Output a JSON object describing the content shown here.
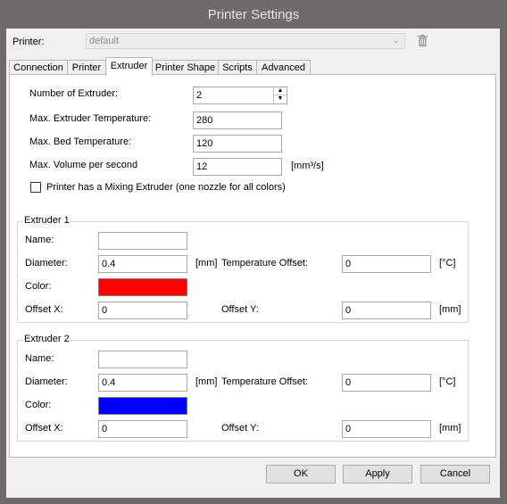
{
  "window": {
    "title": "Printer Settings"
  },
  "printer": {
    "label": "Printer:",
    "value": "default"
  },
  "tabs": [
    {
      "label": "Connection"
    },
    {
      "label": "Printer"
    },
    {
      "label": "Extruder",
      "active": true
    },
    {
      "label": "Printer Shape"
    },
    {
      "label": "Scripts"
    },
    {
      "label": "Advanced"
    }
  ],
  "extruder_page": {
    "num_extruders_label": "Number of Extruder:",
    "num_extruders_value": "2",
    "max_extruder_temp_label": "Max. Extruder Temperature:",
    "max_extruder_temp_value": "280",
    "max_bed_temp_label": "Max. Bed Temperature:",
    "max_bed_temp_value": "120",
    "max_volume_label": "Max. Volume per second",
    "max_volume_value": "12",
    "max_volume_unit": "[mm³/s]",
    "mixing_label": "Printer has a Mixing Extruder (one nozzle for all colors)",
    "mixing_checked": false
  },
  "extruders": [
    {
      "title": "Extruder 1",
      "name_label": "Name:",
      "name_value": "",
      "diameter_label": "Diameter:",
      "diameter_value": "0.4",
      "diameter_unit": "[mm]",
      "temp_offset_label": "Temperature Offset:",
      "temp_offset_value": "0",
      "temp_offset_unit": "[°C]",
      "color_label": "Color:",
      "color": "#ff0000",
      "offset_x_label": "Offset X:",
      "offset_x_value": "0",
      "offset_y_label": "Offset Y:",
      "offset_y_value": "0",
      "offset_y_unit": "[mm]"
    },
    {
      "title": "Extruder 2",
      "name_label": "Name:",
      "name_value": "",
      "diameter_label": "Diameter:",
      "diameter_value": "0.4",
      "diameter_unit": "[mm]",
      "temp_offset_label": "Temperature Offset:",
      "temp_offset_value": "0",
      "temp_offset_unit": "[°C]",
      "color_label": "Color:",
      "color": "#0000ff",
      "offset_x_label": "Offset X:",
      "offset_x_value": "0",
      "offset_y_label": "Offset Y:",
      "offset_y_value": "0",
      "offset_y_unit": "[mm]"
    }
  ],
  "buttons": {
    "ok": "OK",
    "apply": "Apply",
    "cancel": "Cancel"
  },
  "icons": {
    "trash": "trash-icon",
    "dropdown": "chevron-down-icon"
  },
  "colors": {
    "titlebar": "#6f6a6c",
    "window_bg": "#f0f0f0"
  }
}
